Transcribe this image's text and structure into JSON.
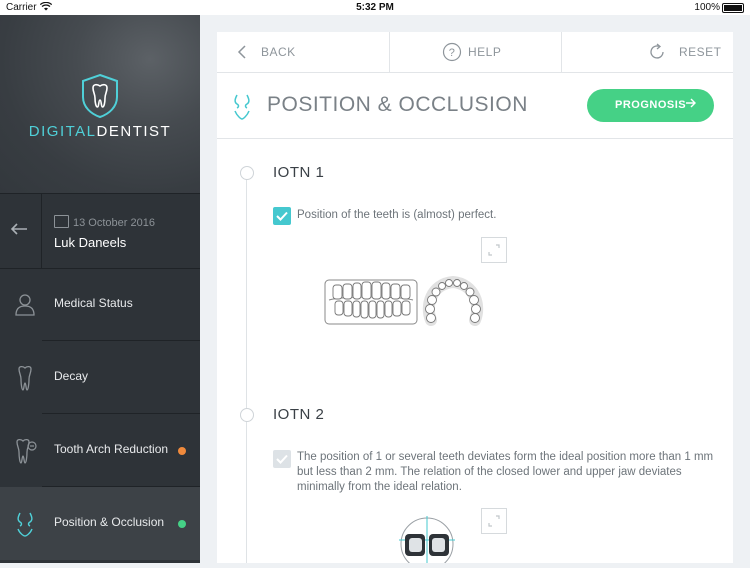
{
  "status_bar": {
    "carrier": "Carrier",
    "time": "5:32 PM",
    "battery": "100%"
  },
  "sidebar": {
    "logo": {
      "part1": "DIGITAL",
      "part2": "DENTIST"
    },
    "patient": {
      "date": "13 October 2016",
      "name": "Luk Daneels"
    },
    "items": [
      {
        "label": "Medical Status",
        "icon": "person-icon"
      },
      {
        "label": "Decay",
        "icon": "tooth-icon"
      },
      {
        "label": "Tooth Arch Reduction",
        "icon": "tooth-reduction-icon",
        "dot_color": "#f08a3c"
      },
      {
        "label": "Position & Occlusion",
        "icon": "occlusion-icon",
        "dot_color": "#45d186"
      }
    ]
  },
  "toolbar": {
    "back": "BACK",
    "help": "HELP",
    "reset": "RESET"
  },
  "page": {
    "title": "POSITION & OCCLUSION",
    "prognosis": "PROGNOSIS"
  },
  "sections": [
    {
      "title": "IOTN 1",
      "option": "Position of the teeth is (almost) perfect.",
      "checked": true
    },
    {
      "title": "IOTN 2",
      "option": "The position of 1 or several teeth deviates form the ideal position more than 1 mm but less than 2 mm. The relation of the closed lower and upper jaw deviates minimally from the ideal relation.",
      "checked": false
    }
  ],
  "colors": {
    "accent": "#45c8cf",
    "green": "#45d186",
    "orange": "#f08a3c"
  }
}
